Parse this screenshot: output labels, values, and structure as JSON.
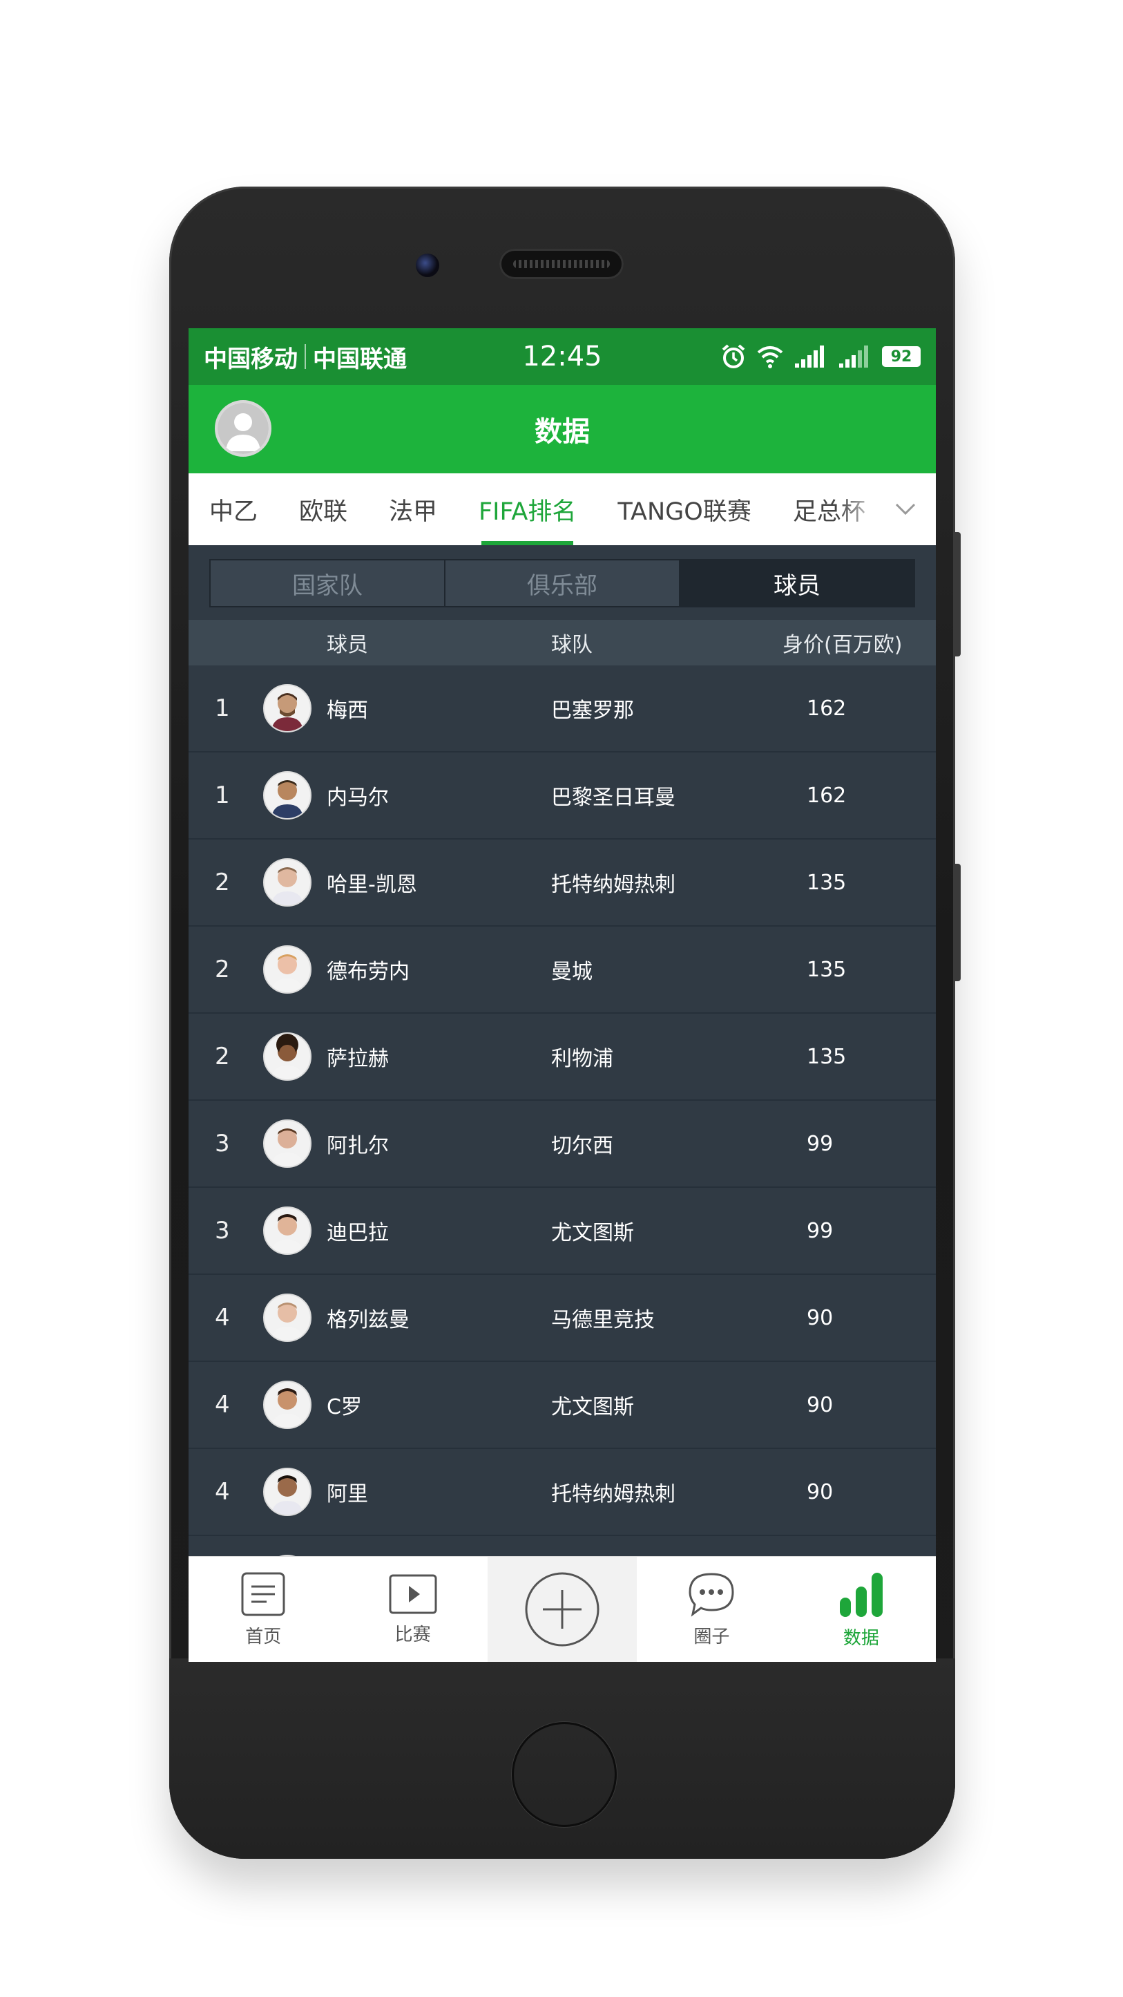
{
  "status": {
    "carrier1": "中国移动",
    "carrier2": "中国联通",
    "time": "12:45",
    "battery": "92"
  },
  "appbar": {
    "title": "数据"
  },
  "tabs": [
    {
      "label": "中乙"
    },
    {
      "label": "欧联"
    },
    {
      "label": "法甲"
    },
    {
      "label": "FIFA排名",
      "active": true
    },
    {
      "label": "TANGO联赛"
    },
    {
      "label": "足总杯"
    }
  ],
  "segments": [
    {
      "label": "国家队"
    },
    {
      "label": "俱乐部"
    },
    {
      "label": "球员",
      "active": true
    }
  ],
  "table": {
    "headers": {
      "player": "球员",
      "team": "球队",
      "value": "身价(百万欧)"
    },
    "rows": [
      {
        "rank": "1",
        "name": "梅西",
        "team": "巴塞罗那",
        "value": "162"
      },
      {
        "rank": "1",
        "name": "内马尔",
        "team": "巴黎圣日耳曼",
        "value": "162"
      },
      {
        "rank": "2",
        "name": "哈里-凯恩",
        "team": "托特纳姆热刺",
        "value": "135"
      },
      {
        "rank": "2",
        "name": "德布劳内",
        "team": "曼城",
        "value": "135"
      },
      {
        "rank": "2",
        "name": "萨拉赫",
        "team": "利物浦",
        "value": "135"
      },
      {
        "rank": "3",
        "name": "阿扎尔",
        "team": "切尔西",
        "value": "99"
      },
      {
        "rank": "3",
        "name": "迪巴拉",
        "team": "尤文图斯",
        "value": "99"
      },
      {
        "rank": "4",
        "name": "格列兹曼",
        "team": "马德里竞技",
        "value": "90"
      },
      {
        "rank": "4",
        "name": "C罗",
        "team": "尤文图斯",
        "value": "90"
      },
      {
        "rank": "4",
        "name": "阿里",
        "team": "托特纳姆热刺",
        "value": "90"
      }
    ]
  },
  "bottom_nav": [
    {
      "label": "首页",
      "icon": "document-icon"
    },
    {
      "label": "比赛",
      "icon": "play-icon"
    },
    {
      "label": "",
      "icon": "plus-circle-icon"
    },
    {
      "label": "圈子",
      "icon": "chat-bubble-icon"
    },
    {
      "label": "数据",
      "icon": "bar-chart-icon",
      "active": true
    }
  ],
  "colors": {
    "statusbar": "#1a8f33",
    "appbar": "#1db33c",
    "accent": "#1ea63a",
    "table_bg": "#303a44"
  }
}
